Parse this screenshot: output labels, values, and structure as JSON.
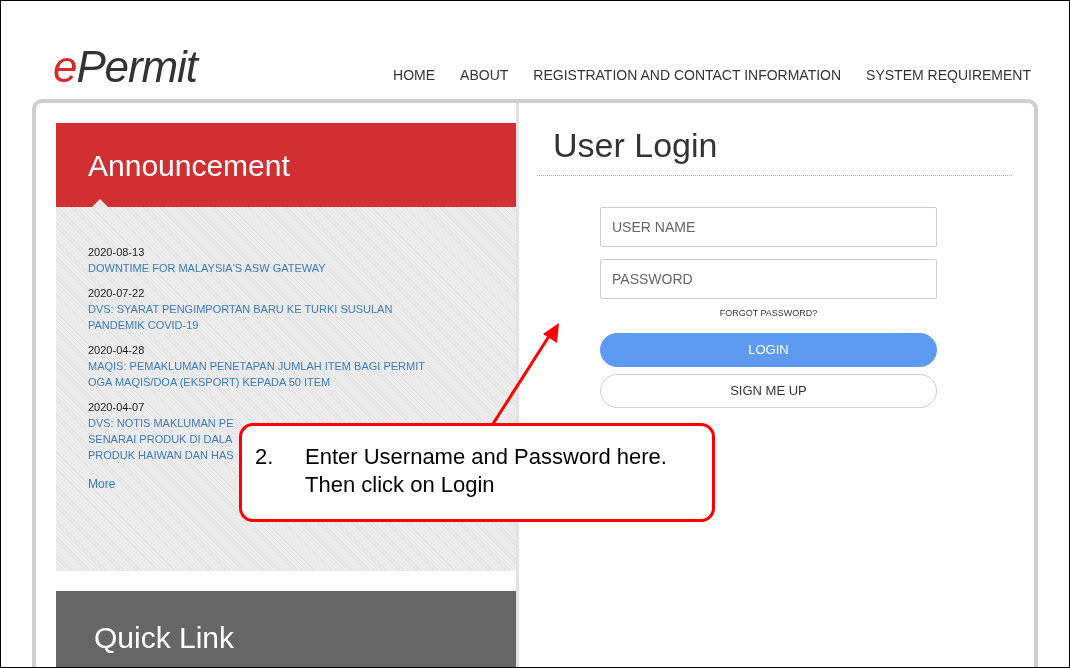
{
  "header": {
    "logo": {
      "accent": "e",
      "rest": "Permit"
    },
    "nav": [
      {
        "label": "HOME"
      },
      {
        "label": "ABOUT"
      },
      {
        "label": "REGISTRATION AND CONTACT INFORMATION"
      },
      {
        "label": "SYSTEM REQUIREMENT"
      }
    ]
  },
  "announcement": {
    "title": "Announcement",
    "items": [
      {
        "date": "2020-08-13",
        "lines": [
          "DOWNTIME FOR MALAYSIA'S ASW GATEWAY"
        ]
      },
      {
        "date": "2020-07-22",
        "lines": [
          "DVS: SYARAT PENGIMPORTAN BARU KE TURKI SUSULAN",
          "PANDEMIK COVID-19"
        ]
      },
      {
        "date": "2020-04-28",
        "lines": [
          "MAQIS: PEMAKLUMAN PENETAPAN JUMLAH ITEM BAGI PERMIT",
          "OGA MAQIS/DOA (EKSPORT) KEPADA 50 ITEM"
        ]
      },
      {
        "date": "2020-04-07",
        "lines": [
          "DVS: NOTIS MAKLUMAN PE",
          "SENARAI PRODUK DI DALA",
          "PRODUK HAIWAN DAN HAS"
        ]
      }
    ],
    "more": "More"
  },
  "quick_link": {
    "title": "Quick Link"
  },
  "login": {
    "title": "User Login",
    "fields": [
      {
        "placeholder": "USER NAME"
      },
      {
        "placeholder": "PASSWORD"
      }
    ],
    "forgot": "FORGOT PASSWORD?",
    "buttons": [
      {
        "label": "LOGIN",
        "kind": "primary"
      },
      {
        "label": "SIGN ME UP",
        "kind": "secondary"
      }
    ]
  },
  "callout": {
    "number": "2.",
    "text": "Enter Username and Password here. Then click on Login"
  }
}
